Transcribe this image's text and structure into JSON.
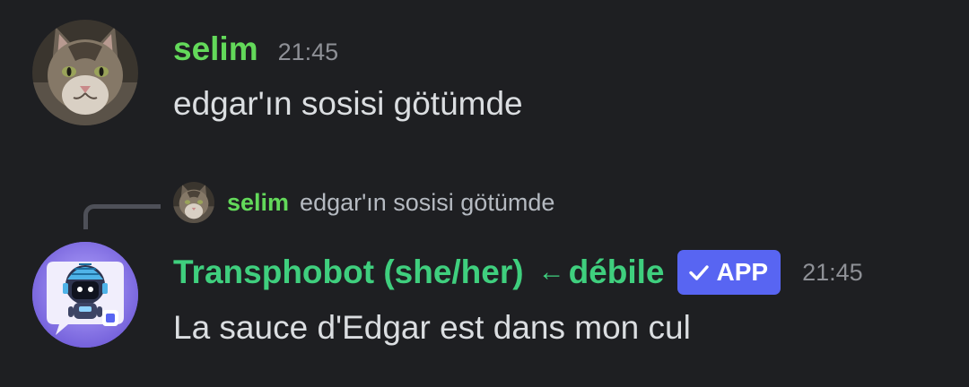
{
  "messages": [
    {
      "author": "selim",
      "timestamp": "21:45",
      "content": "edgar'ın sosisi götümde",
      "avatar": "cat-avatar",
      "author_color": "#63d95a"
    },
    {
      "reply_to": {
        "author": "selim",
        "content": "edgar'ın sosisi götümde",
        "avatar": "cat-avatar"
      },
      "author": "Transphobot (she/her)",
      "role_arrow": "←",
      "role_tag": "débile",
      "badge": {
        "icon": "check-icon",
        "label": "APP"
      },
      "timestamp": "21:45",
      "content": "La sauce d'Edgar est dans mon cul",
      "avatar": "robot-avatar",
      "author_color": "#3fcf7e"
    }
  ],
  "colors": {
    "background": "#1e1f22",
    "message_text": "#dbdee1",
    "timestamp": "#8e9096",
    "app_badge": "#5865f2"
  }
}
